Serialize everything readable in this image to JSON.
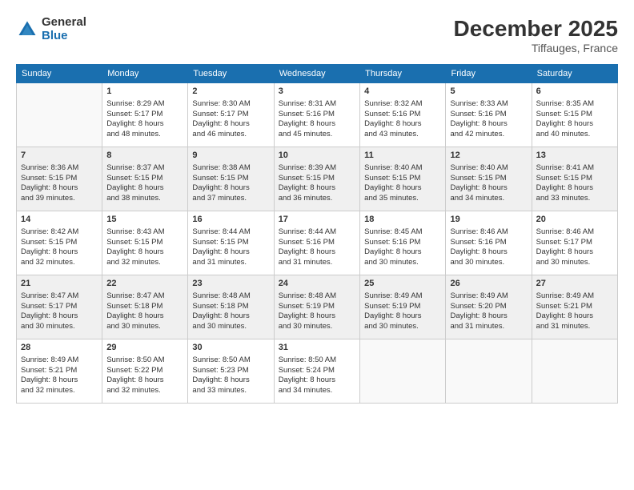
{
  "logo": {
    "general": "General",
    "blue": "Blue"
  },
  "title": "December 2025",
  "subtitle": "Tiffauges, France",
  "days_of_week": [
    "Sunday",
    "Monday",
    "Tuesday",
    "Wednesday",
    "Thursday",
    "Friday",
    "Saturday"
  ],
  "weeks": [
    [
      {
        "day": "",
        "info": ""
      },
      {
        "day": "1",
        "info": "Sunrise: 8:29 AM\nSunset: 5:17 PM\nDaylight: 8 hours\nand 48 minutes."
      },
      {
        "day": "2",
        "info": "Sunrise: 8:30 AM\nSunset: 5:17 PM\nDaylight: 8 hours\nand 46 minutes."
      },
      {
        "day": "3",
        "info": "Sunrise: 8:31 AM\nSunset: 5:16 PM\nDaylight: 8 hours\nand 45 minutes."
      },
      {
        "day": "4",
        "info": "Sunrise: 8:32 AM\nSunset: 5:16 PM\nDaylight: 8 hours\nand 43 minutes."
      },
      {
        "day": "5",
        "info": "Sunrise: 8:33 AM\nSunset: 5:16 PM\nDaylight: 8 hours\nand 42 minutes."
      },
      {
        "day": "6",
        "info": "Sunrise: 8:35 AM\nSunset: 5:15 PM\nDaylight: 8 hours\nand 40 minutes."
      }
    ],
    [
      {
        "day": "7",
        "info": "Sunrise: 8:36 AM\nSunset: 5:15 PM\nDaylight: 8 hours\nand 39 minutes."
      },
      {
        "day": "8",
        "info": "Sunrise: 8:37 AM\nSunset: 5:15 PM\nDaylight: 8 hours\nand 38 minutes."
      },
      {
        "day": "9",
        "info": "Sunrise: 8:38 AM\nSunset: 5:15 PM\nDaylight: 8 hours\nand 37 minutes."
      },
      {
        "day": "10",
        "info": "Sunrise: 8:39 AM\nSunset: 5:15 PM\nDaylight: 8 hours\nand 36 minutes."
      },
      {
        "day": "11",
        "info": "Sunrise: 8:40 AM\nSunset: 5:15 PM\nDaylight: 8 hours\nand 35 minutes."
      },
      {
        "day": "12",
        "info": "Sunrise: 8:40 AM\nSunset: 5:15 PM\nDaylight: 8 hours\nand 34 minutes."
      },
      {
        "day": "13",
        "info": "Sunrise: 8:41 AM\nSunset: 5:15 PM\nDaylight: 8 hours\nand 33 minutes."
      }
    ],
    [
      {
        "day": "14",
        "info": "Sunrise: 8:42 AM\nSunset: 5:15 PM\nDaylight: 8 hours\nand 32 minutes."
      },
      {
        "day": "15",
        "info": "Sunrise: 8:43 AM\nSunset: 5:15 PM\nDaylight: 8 hours\nand 32 minutes."
      },
      {
        "day": "16",
        "info": "Sunrise: 8:44 AM\nSunset: 5:15 PM\nDaylight: 8 hours\nand 31 minutes."
      },
      {
        "day": "17",
        "info": "Sunrise: 8:44 AM\nSunset: 5:16 PM\nDaylight: 8 hours\nand 31 minutes."
      },
      {
        "day": "18",
        "info": "Sunrise: 8:45 AM\nSunset: 5:16 PM\nDaylight: 8 hours\nand 30 minutes."
      },
      {
        "day": "19",
        "info": "Sunrise: 8:46 AM\nSunset: 5:16 PM\nDaylight: 8 hours\nand 30 minutes."
      },
      {
        "day": "20",
        "info": "Sunrise: 8:46 AM\nSunset: 5:17 PM\nDaylight: 8 hours\nand 30 minutes."
      }
    ],
    [
      {
        "day": "21",
        "info": "Sunrise: 8:47 AM\nSunset: 5:17 PM\nDaylight: 8 hours\nand 30 minutes."
      },
      {
        "day": "22",
        "info": "Sunrise: 8:47 AM\nSunset: 5:18 PM\nDaylight: 8 hours\nand 30 minutes."
      },
      {
        "day": "23",
        "info": "Sunrise: 8:48 AM\nSunset: 5:18 PM\nDaylight: 8 hours\nand 30 minutes."
      },
      {
        "day": "24",
        "info": "Sunrise: 8:48 AM\nSunset: 5:19 PM\nDaylight: 8 hours\nand 30 minutes."
      },
      {
        "day": "25",
        "info": "Sunrise: 8:49 AM\nSunset: 5:19 PM\nDaylight: 8 hours\nand 30 minutes."
      },
      {
        "day": "26",
        "info": "Sunrise: 8:49 AM\nSunset: 5:20 PM\nDaylight: 8 hours\nand 31 minutes."
      },
      {
        "day": "27",
        "info": "Sunrise: 8:49 AM\nSunset: 5:21 PM\nDaylight: 8 hours\nand 31 minutes."
      }
    ],
    [
      {
        "day": "28",
        "info": "Sunrise: 8:49 AM\nSunset: 5:21 PM\nDaylight: 8 hours\nand 32 minutes."
      },
      {
        "day": "29",
        "info": "Sunrise: 8:50 AM\nSunset: 5:22 PM\nDaylight: 8 hours\nand 32 minutes."
      },
      {
        "day": "30",
        "info": "Sunrise: 8:50 AM\nSunset: 5:23 PM\nDaylight: 8 hours\nand 33 minutes."
      },
      {
        "day": "31",
        "info": "Sunrise: 8:50 AM\nSunset: 5:24 PM\nDaylight: 8 hours\nand 34 minutes."
      },
      {
        "day": "",
        "info": ""
      },
      {
        "day": "",
        "info": ""
      },
      {
        "day": "",
        "info": ""
      }
    ]
  ]
}
